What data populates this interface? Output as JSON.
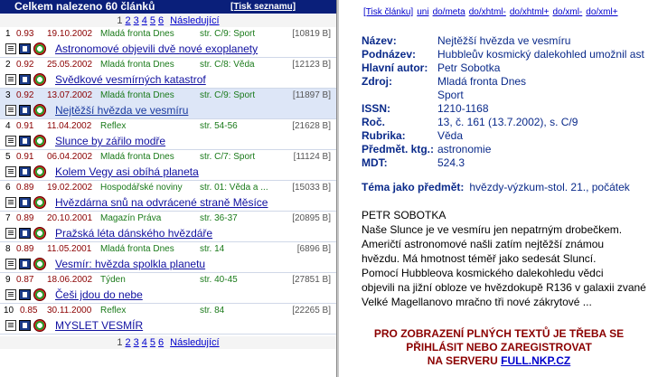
{
  "header": {
    "title": "Celkem nalezeno 60 článků",
    "print_label": "[Tisk seznamu]"
  },
  "pager": {
    "current": "1",
    "pages": [
      "2",
      "3",
      "4",
      "5",
      "6"
    ],
    "next": "Následující"
  },
  "rows": [
    {
      "idx": "1",
      "score": "0.93",
      "date": "19.10.2002",
      "source": "Mladá fronta Dnes",
      "page": "str. C/9: Sport",
      "size": "[10819 B]",
      "title": "Astronomové objevili dvě nové exoplanety"
    },
    {
      "idx": "2",
      "score": "0.92",
      "date": "25.05.2002",
      "source": "Mladá fronta Dnes",
      "page": "str. C/8: Věda",
      "size": "[12123 B]",
      "title": "Svědkové vesmírných katastrof"
    },
    {
      "idx": "3",
      "score": "0.92",
      "date": "13.07.2002",
      "source": "Mladá fronta Dnes",
      "page": "str. C/9: Sport",
      "size": "[11897 B]",
      "title": "Nejtěžší hvězda ve vesmíru"
    },
    {
      "idx": "4",
      "score": "0.91",
      "date": "11.04.2002",
      "source": "Reflex",
      "page": "str. 54-56",
      "size": "[21628 B]",
      "title": "Slunce by zářilo modře"
    },
    {
      "idx": "5",
      "score": "0.91",
      "date": "06.04.2002",
      "source": "Mladá fronta Dnes",
      "page": "str. C/7: Sport",
      "size": "[11124 B]",
      "title": "Kolem Vegy asi obíhá planeta"
    },
    {
      "idx": "6",
      "score": "0.89",
      "date": "19.02.2002",
      "source": "Hospodářské noviny",
      "page": "str. 01: Věda a ...",
      "size": "[15033 B]",
      "title": "Hvězdárna snů na odvrácené straně Měsíce"
    },
    {
      "idx": "7",
      "score": "0.89",
      "date": "20.10.2001",
      "source": "Magazín Práva",
      "page": "str. 36-37",
      "size": "[20895 B]",
      "title": "Pražská léta dánského hvězdáře"
    },
    {
      "idx": "8",
      "score": "0.89",
      "date": "11.05.2001",
      "source": "Mladá fronta Dnes",
      "page": "str. 14",
      "size": "[6896 B]",
      "title": "Vesmír: hvězda spolkla planetu"
    },
    {
      "idx": "9",
      "score": "0.87",
      "date": "18.06.2002",
      "source": "Týden",
      "page": "str. 40-45",
      "size": "[27851 B]",
      "title": "Češi jdou do nebe"
    },
    {
      "idx": "10",
      "score": "0.85",
      "date": "30.11.2000",
      "source": "Reflex",
      "page": "str. 84",
      "size": "[22265 B]",
      "title": "MYSLET VESMÍR"
    }
  ],
  "detail": {
    "links": [
      "[Tisk článku]",
      "uni",
      "do/meta",
      "do/xhtml-",
      "do/xhtml+",
      "do/xml-",
      "do/xml+"
    ],
    "fields": [
      {
        "k": "Název:",
        "v": "Nejtěžší hvězda ve vesmíru"
      },
      {
        "k": "Podnázev:",
        "v": "Hubbleův kosmický dalekohled umožnil ast"
      },
      {
        "k": "Hlavní autor:",
        "v": "Petr Sobotka"
      },
      {
        "k": "Zdroj:",
        "v": "Mladá fronta Dnes"
      },
      {
        "k": "",
        "v": "Sport"
      },
      {
        "k": "ISSN:",
        "v": "1210-1168"
      },
      {
        "k": "Roč.",
        "v": "13, č. 161 (13.7.2002), s. C/9"
      },
      {
        "k": "Rubrika:",
        "v": "Věda"
      },
      {
        "k": "Předmět. ktg.:",
        "v": "astronomie"
      },
      {
        "k": "MDT:",
        "v": "524.3"
      }
    ],
    "topic_label": "Téma jako předmět:",
    "topic_value": "hvězdy-výzkum-stol. 21., počátek",
    "body": [
      "PETR SOBOTKA",
      "Naše Slunce je ve vesmíru jen nepatrným drobečkem.",
      "Američtí astronomové našli zatím nejtěžší známou",
      "hvězdu. Má hmotnost téměř jako sedesát Sluncí.",
      "Pomocí Hubbleova kosmického dalekohledu vědci",
      "objevili na jižní obloze ve hvězdokupě R136 v galaxii zvané",
      "Velké Magellanovo mračno tři nové zákrytové ..."
    ],
    "warning_lines": [
      "PRO ZOBRAZENÍ PLNÝCH TEXTŮ JE TŘEBA SE",
      "PŘIHLÁSIT NEBO ZAREGISTROVAT"
    ],
    "warning_prefix": "NA SERVERU",
    "warning_link": "FULL.NKP.CZ"
  }
}
